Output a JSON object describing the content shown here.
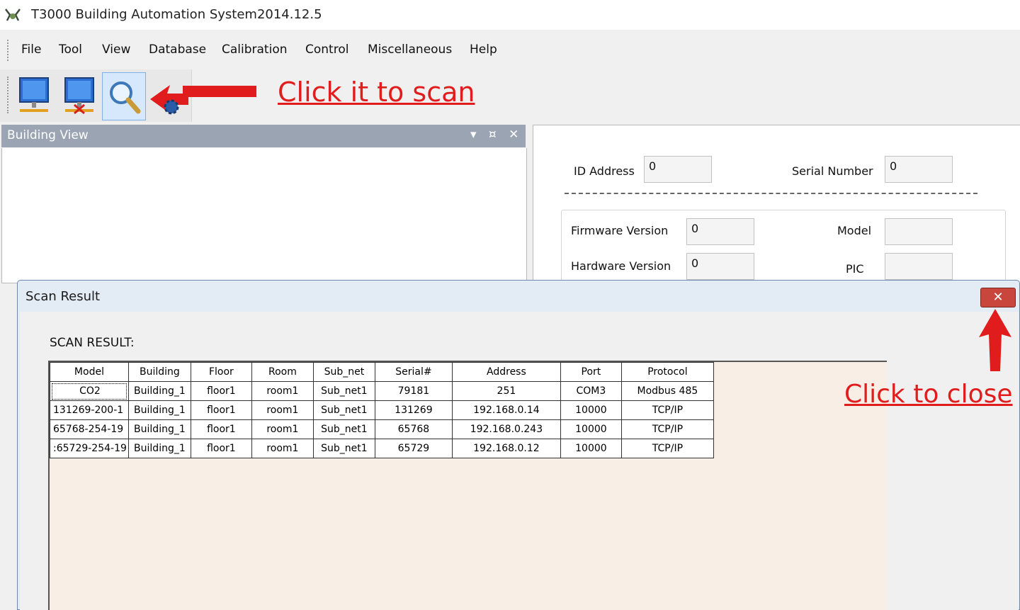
{
  "window": {
    "title": "T3000 Building Automation System2014.12.5"
  },
  "menu": [
    "File",
    "Tool",
    "View",
    "Database",
    "Calibration",
    "Control",
    "Miscellaneous",
    "Help"
  ],
  "annotations": {
    "scan": "Click it to scan",
    "close": "Click to close"
  },
  "building_view": {
    "title": "Building View",
    "controls": "▾ ¤ ✕"
  },
  "device_info": {
    "id_address": {
      "label": "ID Address",
      "value": "0"
    },
    "serial_number": {
      "label": "Serial Number",
      "value": "0"
    },
    "firmware_version": {
      "label": "Firmware Version",
      "value": "0"
    },
    "model": {
      "label": "Model",
      "value": ""
    },
    "hardware_version": {
      "label": "Hardware Version",
      "value": "0"
    },
    "pic": {
      "label": "PIC",
      "value": ""
    }
  },
  "scan_dialog": {
    "title": "Scan Result",
    "close": "✕",
    "label": "SCAN RESULT:",
    "columns": [
      "Model",
      "Building",
      "Floor",
      "Room",
      "Sub_net",
      "Serial#",
      "Address",
      "Port",
      "Protocol"
    ],
    "rows": [
      [
        "CO2",
        "Building_1",
        "floor1",
        "room1",
        "Sub_net1",
        "79181",
        "251",
        "COM3",
        "Modbus 485"
      ],
      [
        "131269-200-1",
        "Building_1",
        "floor1",
        "room1",
        "Sub_net1",
        "131269",
        "192.168.0.14",
        "10000",
        "TCP/IP"
      ],
      [
        "65768-254-19",
        "Building_1",
        "floor1",
        "room1",
        "Sub_net1",
        "65768",
        "192.168.0.243",
        "10000",
        "TCP/IP"
      ],
      [
        ":65729-254-19",
        "Building_1",
        "floor1",
        "room1",
        "Sub_net1",
        "65729",
        "192.168.0.12",
        "10000",
        "TCP/IP"
      ]
    ]
  },
  "colors": {
    "annotation": "#e11c1c",
    "dialog_frame": "#e3ebf5",
    "grid_background": "#f9eee5",
    "close_button": "#c8463b"
  }
}
